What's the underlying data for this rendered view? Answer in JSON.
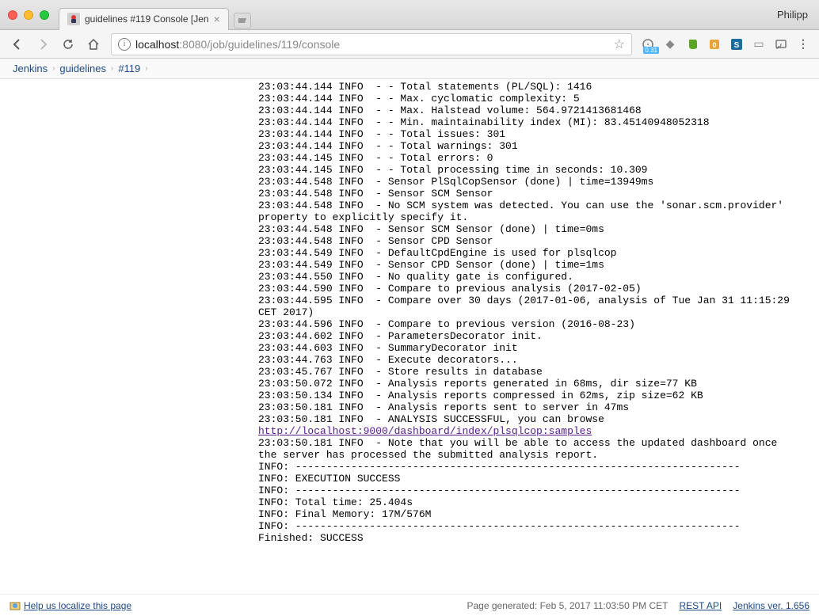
{
  "browser": {
    "tab_title": "guidelines #119 Console [Jen",
    "profile": "Philipp",
    "url_host": "localhost",
    "url_port": ":8080",
    "url_path": "/job/guidelines/119/console",
    "ext_badge": "0.31"
  },
  "breadcrumb": {
    "items": [
      "Jenkins",
      "guidelines",
      "#119"
    ]
  },
  "console": {
    "lines": [
      "23:03:44.144 INFO  - - Total statements (PL/SQL): 1416",
      "23:03:44.144 INFO  - - Max. cyclomatic complexity: 5",
      "23:03:44.144 INFO  - - Max. Halstead volume: 564.9721413681468",
      "23:03:44.144 INFO  - - Min. maintainability index (MI): 83.45140948052318",
      "23:03:44.144 INFO  - - Total issues: 301",
      "23:03:44.144 INFO  - - Total warnings: 301",
      "23:03:44.145 INFO  - - Total errors: 0",
      "23:03:44.145 INFO  - - Total processing time in seconds: 10.309",
      "23:03:44.548 INFO  - Sensor PlSqlCopSensor (done) | time=13949ms",
      "23:03:44.548 INFO  - Sensor SCM Sensor",
      "23:03:44.548 INFO  - No SCM system was detected. You can use the 'sonar.scm.provider'",
      "property to explicitly specify it.",
      "23:03:44.548 INFO  - Sensor SCM Sensor (done) | time=0ms",
      "23:03:44.548 INFO  - Sensor CPD Sensor",
      "23:03:44.549 INFO  - DefaultCpdEngine is used for plsqlcop",
      "23:03:44.549 INFO  - Sensor CPD Sensor (done) | time=1ms",
      "23:03:44.550 INFO  - No quality gate is configured.",
      "23:03:44.590 INFO  - Compare to previous analysis (2017-02-05)",
      "23:03:44.595 INFO  - Compare over 30 days (2017-01-06, analysis of Tue Jan 31 11:15:29",
      "CET 2017)",
      "23:03:44.596 INFO  - Compare to previous version (2016-08-23)",
      "23:03:44.602 INFO  - ParametersDecorator init.",
      "23:03:44.603 INFO  - SummaryDecorator init",
      "23:03:44.763 INFO  - Execute decorators...",
      "23:03:45.767 INFO  - Store results in database",
      "23:03:50.072 INFO  - Analysis reports generated in 68ms, dir size=77 KB",
      "23:03:50.134 INFO  - Analysis reports compressed in 62ms, zip size=62 KB",
      "23:03:50.181 INFO  - Analysis reports sent to server in 47ms",
      "23:03:50.181 INFO  - ANALYSIS SUCCESSFUL, you can browse "
    ],
    "link": "http://localhost:9000/dashboard/index/plsqlcop:samples",
    "lines2": [
      "23:03:50.181 INFO  - Note that you will be able to access the updated dashboard once",
      "the server has processed the submitted analysis report.",
      "INFO: ------------------------------------------------------------------------",
      "INFO: EXECUTION SUCCESS",
      "INFO: ------------------------------------------------------------------------",
      "INFO: Total time: 25.404s",
      "INFO: Final Memory: 17M/576M",
      "INFO: ------------------------------------------------------------------------",
      "Finished: SUCCESS"
    ]
  },
  "footer": {
    "localize": "Help us localize this page",
    "generated": "Page generated: Feb 5, 2017 11:03:50 PM CET",
    "rest_api": "REST API",
    "version": "Jenkins ver. 1.656"
  }
}
